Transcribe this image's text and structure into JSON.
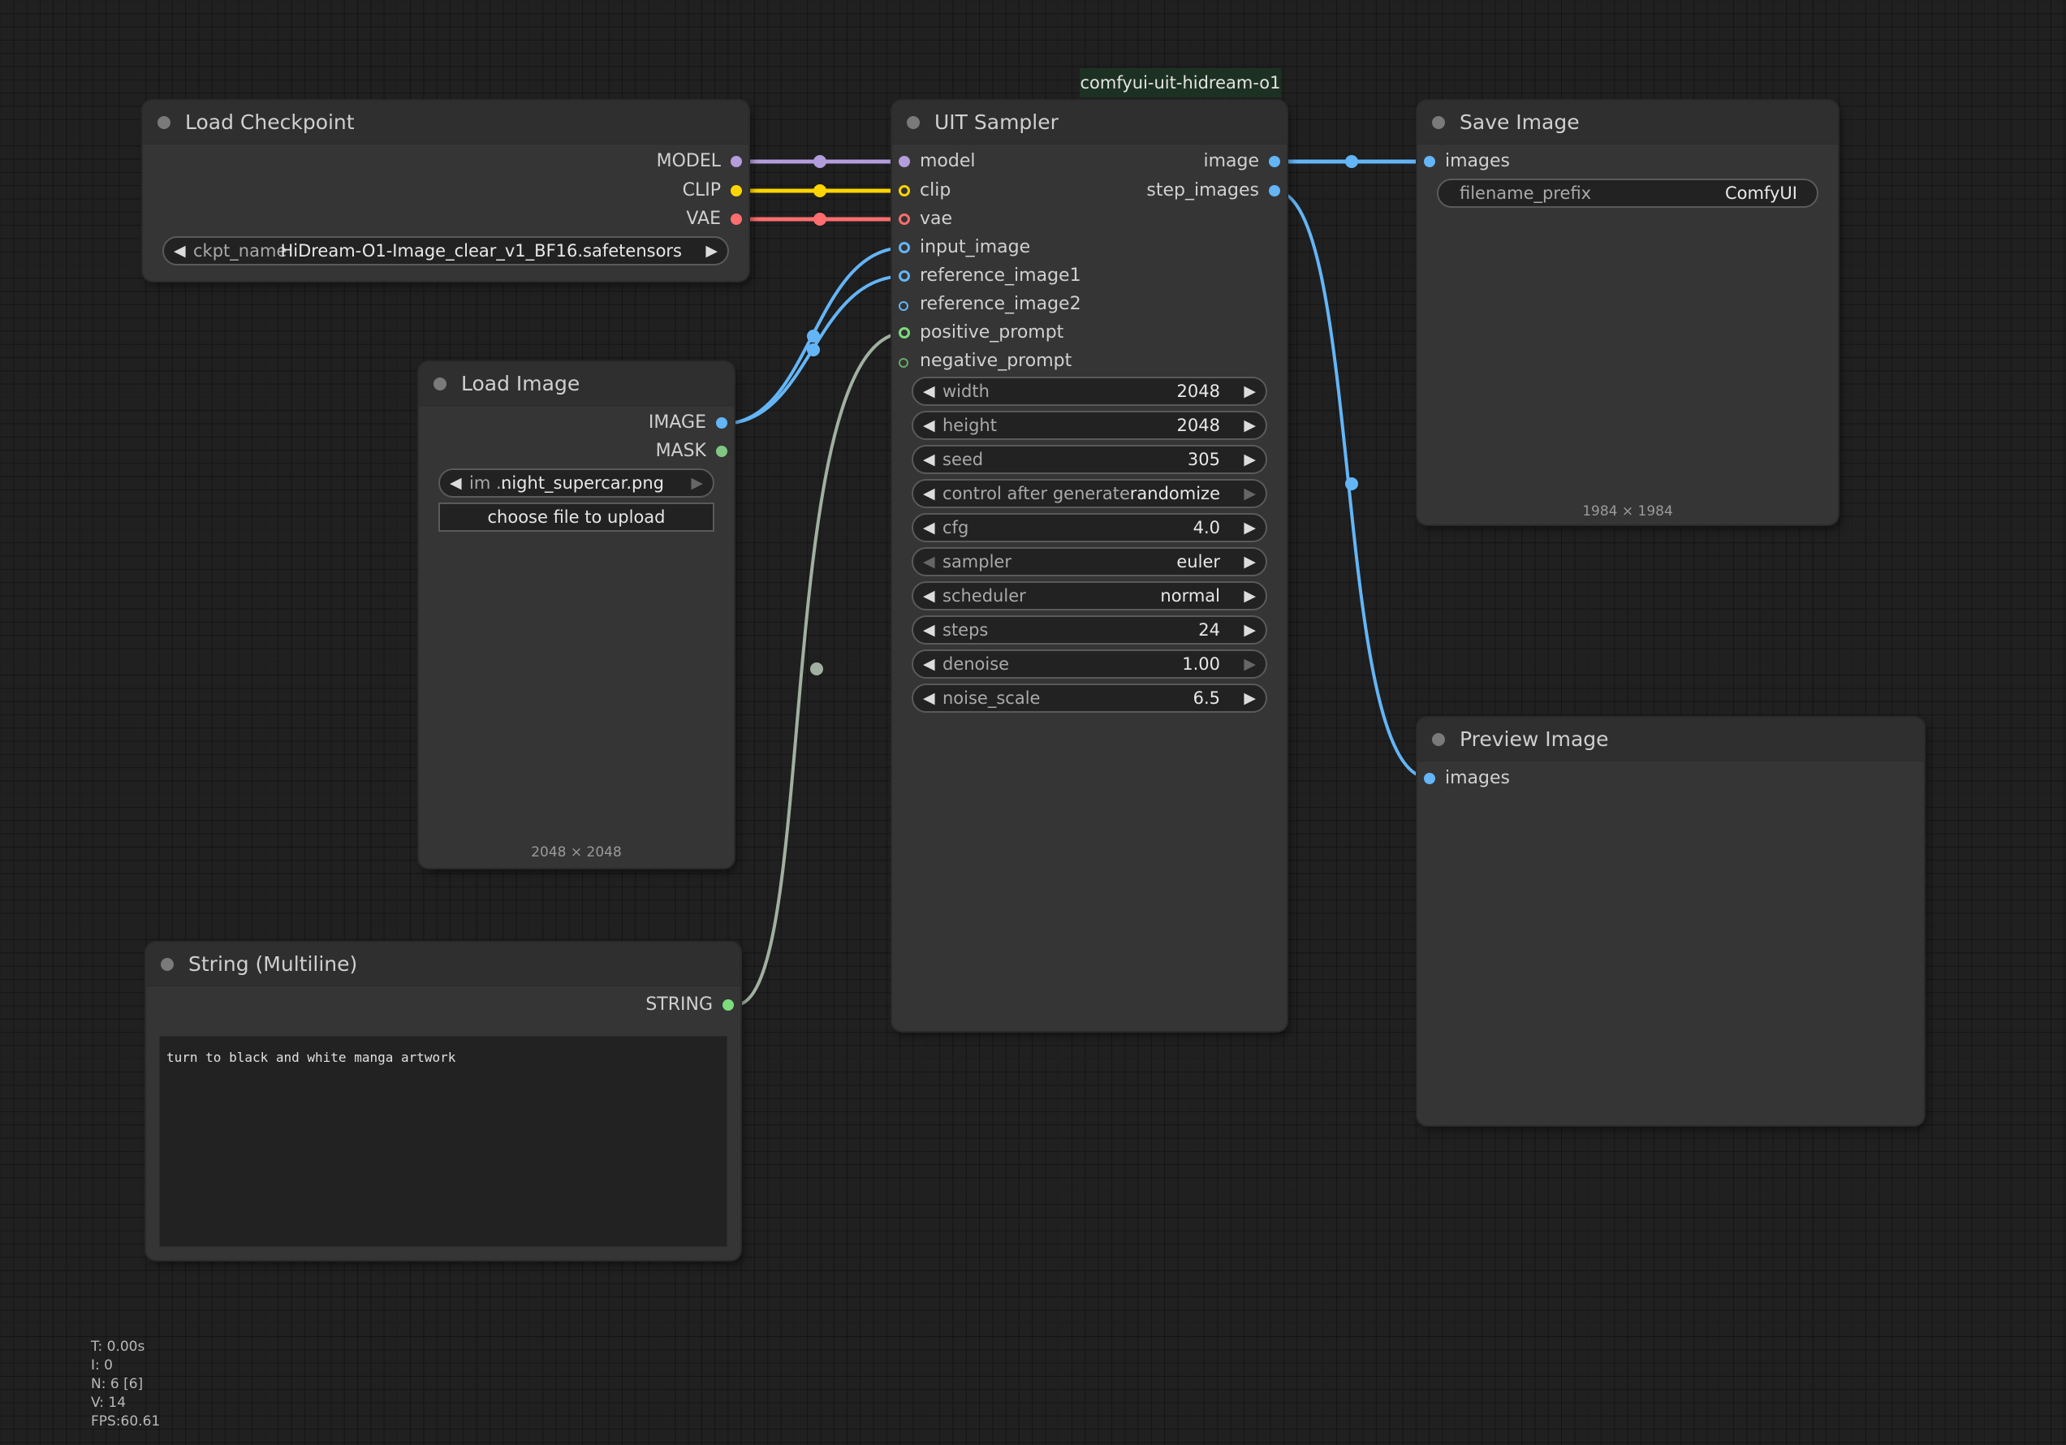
{
  "colors": {
    "model": "#b39ddb",
    "clip": "#ffd500",
    "vae": "#ff6e6e",
    "image": "#64b5f6",
    "mask": "#81c784",
    "string": "#a1b0a1",
    "positive": "#7ddc7d",
    "negative": "#68a868"
  },
  "nodes": {
    "load_checkpoint": {
      "title": "Load Checkpoint",
      "outputs": [
        "MODEL",
        "CLIP",
        "VAE"
      ],
      "ckpt_name": {
        "label": "ckpt_name",
        "value": "HiDream-O1-Image_clear_v1_BF16.safetensors"
      }
    },
    "load_image": {
      "title": "Load Image",
      "outputs": [
        "IMAGE",
        "MASK"
      ],
      "image": {
        "label": "im ...",
        "value": "night_supercar.png"
      },
      "upload_label": "choose file to upload",
      "size": "2048 × 2048"
    },
    "string_multiline": {
      "title": "String (Multiline)",
      "output": "STRING",
      "text": "turn to black and white manga artwork"
    },
    "uit_sampler": {
      "badge": "comfyui-uit-hidream-o1",
      "title": "UIT Sampler",
      "inputs": [
        "model",
        "clip",
        "vae",
        "input_image",
        "reference_image1",
        "reference_image2",
        "positive_prompt",
        "negative_prompt"
      ],
      "outputs": [
        "image",
        "step_images"
      ],
      "widgets": [
        {
          "label": "width",
          "value": "2048"
        },
        {
          "label": "height",
          "value": "2048"
        },
        {
          "label": "seed",
          "value": "305"
        },
        {
          "label": "control after generate",
          "value": "randomize"
        },
        {
          "label": "cfg",
          "value": "4.0"
        },
        {
          "label": "sampler",
          "value": "euler"
        },
        {
          "label": "scheduler",
          "value": "normal"
        },
        {
          "label": "steps",
          "value": "24"
        },
        {
          "label": "denoise",
          "value": "1.00"
        },
        {
          "label": "noise_scale",
          "value": "6.5"
        }
      ]
    },
    "save_image": {
      "title": "Save Image",
      "input": "images",
      "filename_prefix": {
        "label": "filename_prefix",
        "value": "ComfyUI"
      },
      "size": "1984 × 1984"
    },
    "preview_image": {
      "title": "Preview Image",
      "input": "images"
    }
  },
  "stats": [
    "T: 0.00s",
    "I: 0",
    "N: 6 [6]",
    "V: 14",
    "FPS:60.61"
  ]
}
